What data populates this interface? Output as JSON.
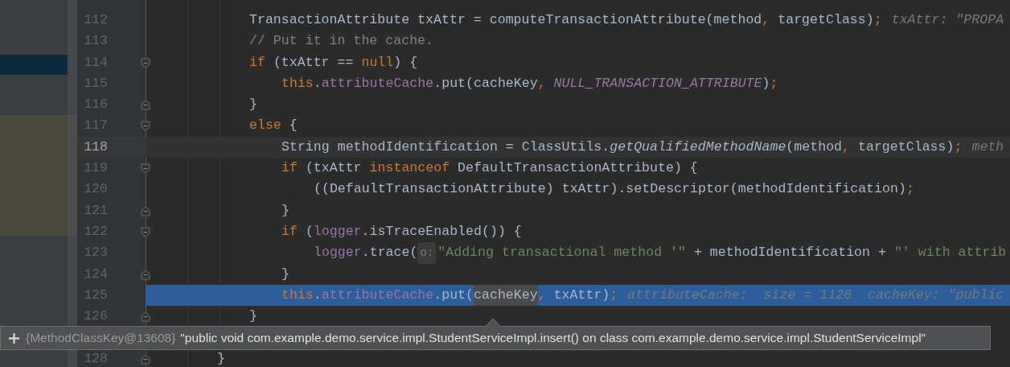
{
  "editor": {
    "lines": [
      {
        "children": [
          {
            "number": "112",
            "fold_start": false,
            "fold_end": false,
            "current_line": false,
            "execution_point": false,
            "tokens": [
              {
                "kind": "text",
                "text": "TransactionAttribute txAttr = computeTransactionAttribute(method"
              },
              {
                "kind": "keyword",
                "text": ", "
              },
              {
                "kind": "text",
                "text": "targetClass)"
              },
              {
                "kind": "keyword",
                "text": ";"
              },
              {
                "kind": "hint",
                "text": "txAttr: \"PROPA"
              }
            ]
          },
          {
            "number": "113",
            "fold_start": false,
            "fold_end": false,
            "current_line": false,
            "execution_point": false,
            "tokens": [
              {
                "kind": "comment",
                "text": "// Put it in the cache."
              }
            ]
          },
          {
            "number": "114",
            "fold_start": true,
            "fold_end": false,
            "current_line": false,
            "execution_point": false,
            "tokens": [
              {
                "kind": "keyword",
                "text": "if "
              },
              {
                "kind": "text",
                "text": "(txAttr == "
              },
              {
                "kind": "keyword",
                "text": "null"
              },
              {
                "kind": "text",
                "text": ") {"
              }
            ],
            "children": [
              {
                "number": "115",
                "fold_start": false,
                "fold_end": false,
                "current_line": false,
                "execution_point": false,
                "tokens": [
                  {
                    "kind": "keyword",
                    "text": "this"
                  },
                  {
                    "kind": "text",
                    "text": "."
                  },
                  {
                    "kind": "field",
                    "text": "attributeCache"
                  },
                  {
                    "kind": "text",
                    "text": ".put(cacheKey"
                  },
                  {
                    "kind": "keyword",
                    "text": ", "
                  },
                  {
                    "kind": "constant",
                    "text": "NULL_TRANSACTION_ATTRIBUTE"
                  },
                  {
                    "kind": "text",
                    "text": ")"
                  },
                  {
                    "kind": "keyword",
                    "text": ";"
                  }
                ]
              }
            ]
          },
          {
            "number": "116",
            "fold_start": false,
            "fold_end": true,
            "current_line": false,
            "execution_point": false,
            "tokens": [
              {
                "kind": "text",
                "text": "}"
              }
            ]
          },
          {
            "number": "117",
            "fold_start": true,
            "fold_end": false,
            "current_line": false,
            "execution_point": false,
            "tokens": [
              {
                "kind": "keyword",
                "text": "else "
              },
              {
                "kind": "text",
                "text": "{"
              }
            ],
            "children": [
              {
                "number": "118",
                "fold_start": false,
                "fold_end": false,
                "current_line": true,
                "execution_point": false,
                "tokens": [
                  {
                    "kind": "text",
                    "text": "String methodIdentification = ClassUtils."
                  },
                  {
                    "kind": "italic",
                    "text": "getQualifiedMethodName"
                  },
                  {
                    "kind": "text",
                    "text": "(method"
                  },
                  {
                    "kind": "keyword",
                    "text": ", "
                  },
                  {
                    "kind": "text",
                    "text": "targetClass)"
                  },
                  {
                    "kind": "keyword",
                    "text": ";"
                  },
                  {
                    "kind": "hint",
                    "text": "meth"
                  }
                ]
              },
              {
                "number": "119",
                "fold_start": true,
                "fold_end": false,
                "current_line": false,
                "execution_point": false,
                "tokens": [
                  {
                    "kind": "keyword",
                    "text": "if "
                  },
                  {
                    "kind": "text",
                    "text": "(txAttr "
                  },
                  {
                    "kind": "keyword",
                    "text": "instanceof "
                  },
                  {
                    "kind": "text",
                    "text": "DefaultTransactionAttribute) {"
                  }
                ],
                "children": [
                  {
                    "number": "120",
                    "fold_start": false,
                    "fold_end": false,
                    "current_line": false,
                    "execution_point": false,
                    "tokens": [
                      {
                        "kind": "text",
                        "text": "((DefaultTransactionAttribute) txAttr).setDescriptor(methodIdentification)"
                      },
                      {
                        "kind": "keyword",
                        "text": ";"
                      }
                    ]
                  }
                ]
              },
              {
                "number": "121",
                "fold_start": false,
                "fold_end": true,
                "current_line": false,
                "execution_point": false,
                "tokens": [
                  {
                    "kind": "text",
                    "text": "}"
                  }
                ]
              },
              {
                "number": "122",
                "fold_start": true,
                "fold_end": false,
                "current_line": false,
                "execution_point": false,
                "tokens": [
                  {
                    "kind": "keyword",
                    "text": "if "
                  },
                  {
                    "kind": "text",
                    "text": "("
                  },
                  {
                    "kind": "field",
                    "text": "logger"
                  },
                  {
                    "kind": "text",
                    "text": ".isTraceEnabled()) {"
                  }
                ],
                "children": [
                  {
                    "number": "123",
                    "fold_start": false,
                    "fold_end": false,
                    "current_line": false,
                    "execution_point": false,
                    "tokens": [
                      {
                        "kind": "field",
                        "text": "logger"
                      },
                      {
                        "kind": "text",
                        "text": ".trace("
                      },
                      {
                        "kind": "param",
                        "text": "o:"
                      },
                      {
                        "kind": "string",
                        "text": "\"Adding transactional method '\" "
                      },
                      {
                        "kind": "text",
                        "text": "+ methodIdentification + "
                      },
                      {
                        "kind": "string",
                        "text": "\"' with attrib"
                      }
                    ]
                  }
                ]
              },
              {
                "number": "124",
                "fold_start": false,
                "fold_end": true,
                "current_line": false,
                "execution_point": false,
                "tokens": [
                  {
                    "kind": "text",
                    "text": "}"
                  }
                ]
              },
              {
                "number": "125",
                "fold_start": false,
                "fold_end": false,
                "current_line": false,
                "execution_point": true,
                "tokens": [
                  {
                    "kind": "keyword",
                    "text": "this"
                  },
                  {
                    "kind": "text",
                    "text": "."
                  },
                  {
                    "kind": "field",
                    "text": "attributeCache"
                  },
                  {
                    "kind": "text",
                    "text": ".put("
                  },
                  {
                    "kind": "selection",
                    "text": "cacheKey"
                  },
                  {
                    "kind": "keyword",
                    "text": ", "
                  },
                  {
                    "kind": "text",
                    "text": "txAttr)"
                  },
                  {
                    "kind": "keyword",
                    "text": ";"
                  },
                  {
                    "kind": "hint",
                    "text": "attributeCache:  size = 1126  cacheKey: \"public"
                  }
                ]
              }
            ]
          },
          {
            "number": "126",
            "fold_start": false,
            "fold_end": true,
            "current_line": false,
            "execution_point": false,
            "tokens": [
              {
                "kind": "text",
                "text": "}"
              }
            ]
          }
        ]
      },
      {
        "number": "128",
        "fold_start": false,
        "fold_end": true,
        "current_line": false,
        "execution_point": false,
        "tokens": [
          {
            "kind": "text",
            "text": "}"
          }
        ]
      }
    ]
  },
  "tooltip": {
    "key": "{MethodClassKey@13608}",
    "value": "\"public void com.example.demo.service.impl.StudentServiceImpl.insert() on class com.example.demo.service.impl.StudentServiceImpl\""
  }
}
